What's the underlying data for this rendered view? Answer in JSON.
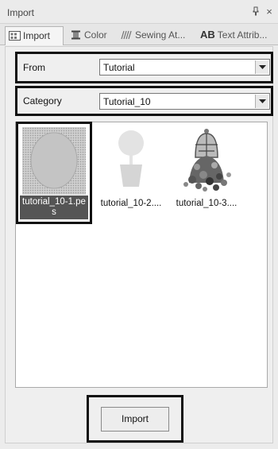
{
  "panel": {
    "title": "Import",
    "pin_glyph": "⨅",
    "close_glyph": "×"
  },
  "tabs": [
    {
      "label": "Import",
      "icon": "import-tab-icon",
      "active": true
    },
    {
      "label": "Color",
      "icon": "color-tab-icon",
      "active": false
    },
    {
      "label": "Sewing At...",
      "icon": "sewing-attributes-tab-icon",
      "active": false
    },
    {
      "label": "Text Attrib...",
      "icon": "text-attributes-tab-icon",
      "icon_text": "AB",
      "active": false
    }
  ],
  "from": {
    "label": "From",
    "value": "Tutorial"
  },
  "category": {
    "label": "Category",
    "value": "Tutorial_10"
  },
  "files": [
    {
      "name_line1": "tutorial_10-1.pe",
      "name_line2": "s",
      "selected": true
    },
    {
      "name": "tutorial_10-2....",
      "selected": false
    },
    {
      "name": "tutorial_10-3....",
      "selected": false
    }
  ],
  "import_button": {
    "label": "Import"
  },
  "colors": {
    "highlight_border": "#111111",
    "selection_bg": "#555555"
  }
}
